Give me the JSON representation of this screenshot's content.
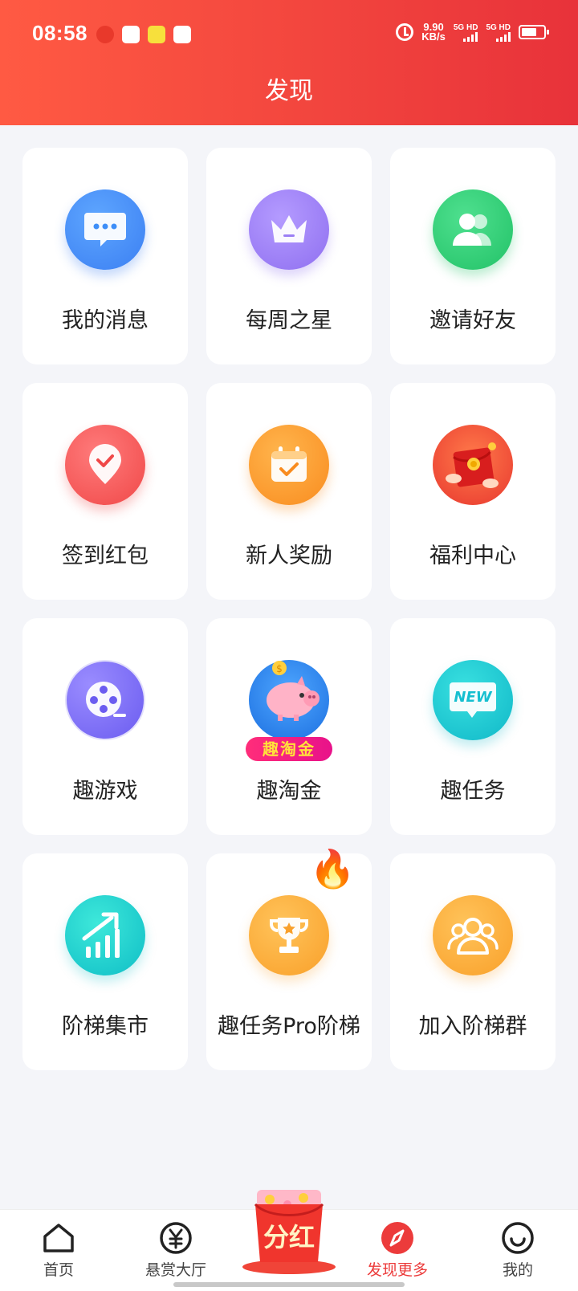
{
  "status_bar": {
    "time": "08:58",
    "net_speed_value": "9.90",
    "net_speed_unit": "KB/s",
    "sim1": "5G HD",
    "sim2": "5G HD"
  },
  "header": {
    "title": "发现"
  },
  "grid": {
    "items": [
      {
        "label": "我的消息",
        "icon": "message-icon",
        "color": "#3d8ef8"
      },
      {
        "label": "每周之星",
        "icon": "crown-icon",
        "color": "#9c7ff5"
      },
      {
        "label": "邀请好友",
        "icon": "friends-icon",
        "color": "#2ecc71"
      },
      {
        "label": "签到红包",
        "icon": "check-location-icon",
        "color": "#f75b5b"
      },
      {
        "label": "新人奖励",
        "icon": "calendar-check-icon",
        "color": "#fb9b2f"
      },
      {
        "label": "福利中心",
        "icon": "red-envelope-icon",
        "color": "#e8382f"
      },
      {
        "label": "趣游戏",
        "icon": "film-reel-icon",
        "color": "#7a6cf5"
      },
      {
        "label": "趣淘金",
        "icon": "piggy-bank-icon",
        "color": "#2f8af0",
        "badge_text": "趣淘金"
      },
      {
        "label": "趣任务",
        "icon": "new-icon",
        "color": "#1ccfd0",
        "badge_text": "NEW"
      },
      {
        "label": "阶梯集市",
        "icon": "growth-chart-icon",
        "color": "#19d2c8"
      },
      {
        "label": "趣任务Pro阶梯",
        "icon": "trophy-icon",
        "color": "#fbb03b",
        "hot_icon": "fire-icon"
      },
      {
        "label": "加入阶梯群",
        "icon": "group-icon",
        "color": "#fbb03b"
      }
    ]
  },
  "bottom_nav": {
    "items": [
      {
        "label": "首页",
        "icon": "home-icon"
      },
      {
        "label": "悬赏大厅",
        "icon": "yen-icon"
      },
      {
        "label": "发现更多",
        "icon": "compass-icon",
        "active": true
      },
      {
        "label": "我的",
        "icon": "smile-icon"
      }
    ],
    "center": {
      "label": "分红",
      "icon": "red-packet-icon"
    }
  },
  "colors": {
    "header_start": "#ff5a43",
    "header_end": "#e8323a",
    "active": "#ec3b3b",
    "background": "#f4f5f9"
  }
}
